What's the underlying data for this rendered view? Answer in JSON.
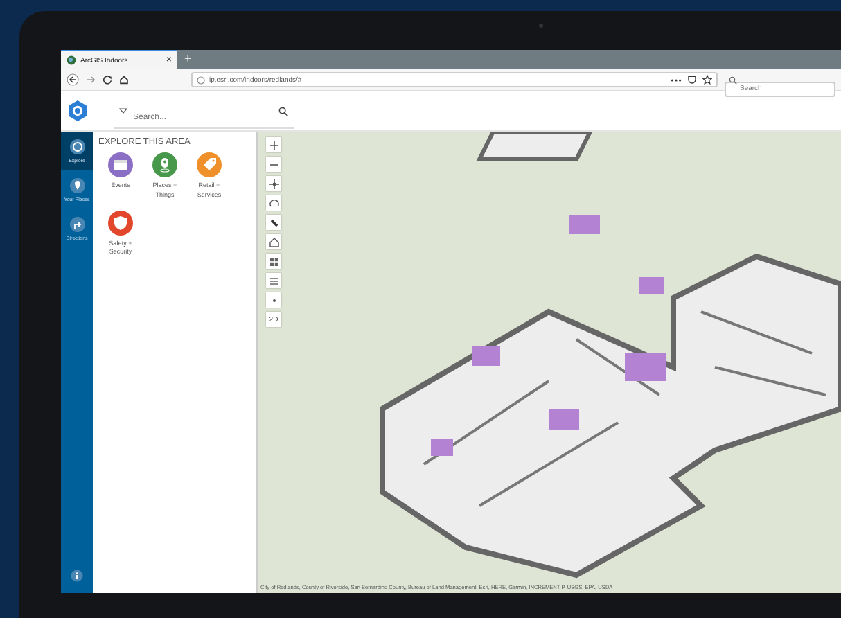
{
  "browser": {
    "tab": {
      "title": "ArcGIS Indoors",
      "close": "×",
      "selected": true
    },
    "new_tab": "+",
    "url": "ip.esri.com/indoors/redlands/#",
    "search": {
      "placeholder": "Search"
    }
  },
  "app": {
    "search": {
      "placeholder": "Search..."
    }
  },
  "rail": [
    {
      "label": "Explore",
      "selected": true
    },
    {
      "label": "Your Places",
      "selected": false
    },
    {
      "label": "Directions",
      "selected": false
    }
  ],
  "panel": {
    "title": "EXPLORE THIS AREA",
    "categories": [
      {
        "label": "Events",
        "kind": "calendar",
        "color": "#8a6fc4"
      },
      {
        "label": "Places + Things",
        "kind": "pin",
        "color": "#47984a"
      },
      {
        "label": "Retail + Services",
        "kind": "tag",
        "color": "#f0902a"
      },
      {
        "label": "Safety + Security",
        "kind": "shield",
        "color": "#e2472c"
      }
    ]
  },
  "map": {
    "tools": [
      {
        "kind": "zoom-in"
      },
      {
        "kind": "zoom-out"
      },
      {
        "kind": "pan"
      },
      {
        "kind": "rotate"
      },
      {
        "kind": "compass"
      },
      {
        "kind": "home"
      },
      {
        "kind": "basemap"
      },
      {
        "kind": "layers"
      },
      {
        "kind": "locate"
      },
      {
        "kind": "view",
        "label": "2D"
      }
    ],
    "attribution": "City of Redlands, County of Riverside, San Bernardino County, Bureau of Land Management, Esri, HERE, Garmin, INCREMENT P, USGS, EPA, USDA"
  }
}
